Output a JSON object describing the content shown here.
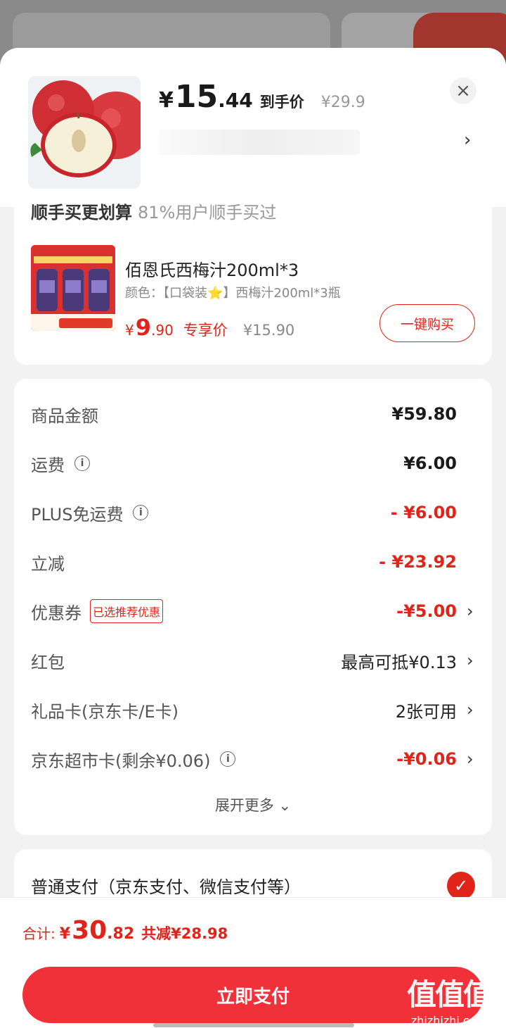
{
  "header": {
    "currency": "¥",
    "price_int": "15",
    "price_dec": ".44",
    "price_label": "到手价",
    "original_price": "¥29.9",
    "close_glyph": "×",
    "chevron_glyph": "›"
  },
  "recommend": {
    "title": "顺手买更划算",
    "subtitle": "81%用户顺手买过",
    "product_name": "佰恩氏西梅汁200ml*3",
    "product_spec": "颜色：【口袋装⭐】西梅汁200ml*3瓶",
    "currency": "¥",
    "price_int": "9",
    "price_dec": ".90",
    "price_tag": "专享价",
    "original_price": "¥15.90",
    "buy_button": "一键购买"
  },
  "cost": {
    "rows": [
      {
        "label": "商品金额",
        "value": "¥59.80"
      },
      {
        "label": "运费",
        "value": "¥6.00"
      },
      {
        "label": "PLUS免运费",
        "value": "- ¥6.00"
      },
      {
        "label": "立减",
        "value": "- ¥23.92"
      },
      {
        "label": "优惠券",
        "badge": "已选推荐优惠",
        "value": "-¥5.00"
      },
      {
        "label": "红包",
        "value": "最高可抵¥0.13"
      },
      {
        "label": "礼品卡(京东卡/E卡)",
        "value": "2张可用"
      },
      {
        "label": "京东超市卡(剩余¥0.06)",
        "value": "-¥0.06"
      }
    ],
    "expand_more": "展开更多 ⌄",
    "info_glyph": "i",
    "chevron_glyph": "›"
  },
  "payment": {
    "method": "普通支付（京东支付、微信支付等）",
    "check_glyph": "✓"
  },
  "footer": {
    "total_label": "合计:",
    "currency": "¥",
    "total_int": "30",
    "total_dec": ".82",
    "savings": "共减¥28.98",
    "pay_button": "立即支付",
    "watermark_big": "值值值",
    "watermark_small": "zhizhizhi.com"
  },
  "colors": {
    "accent_red": "#e2231a",
    "pay_button": "#f0313a"
  }
}
